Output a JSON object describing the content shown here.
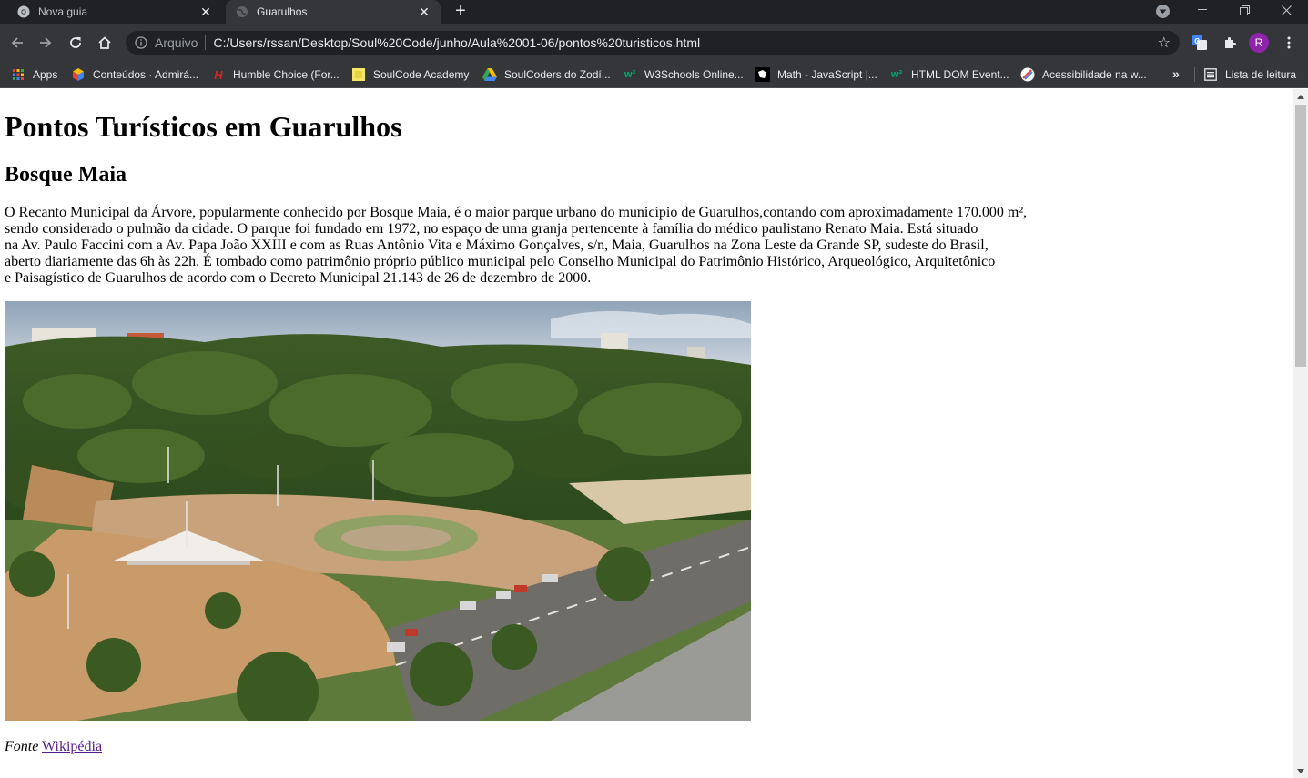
{
  "browser": {
    "tabs": [
      {
        "title": "Nova guia",
        "active": false
      },
      {
        "title": "Guarulhos",
        "active": true
      }
    ],
    "omnibox": {
      "scheme_label": "Arquivo",
      "url": "C:/Users/rssan/Desktop/Soul%20Code/junho/Aula%2001-06/pontos%20turisticos.html"
    },
    "profile_initial": "R",
    "bookmarks": [
      {
        "label": "Apps",
        "icon": "apps-grid-icon"
      },
      {
        "label": "Conteúdos · Admirá...",
        "icon": "colorful-cube-icon"
      },
      {
        "label": "Humble Choice (For...",
        "icon": "humble-h-icon"
      },
      {
        "label": "SoulCode Academy",
        "icon": "soulcode-icon"
      },
      {
        "label": "SoulCoders do Zodí...",
        "icon": "google-drive-icon"
      },
      {
        "label": "W3Schools Online...",
        "icon": "w3schools-icon"
      },
      {
        "label": "Math - JavaScript |...",
        "icon": "mdn-icon"
      },
      {
        "label": "HTML DOM Event...",
        "icon": "w3schools-icon"
      },
      {
        "label": "Acessibilidade na w...",
        "icon": "accessibility-icon"
      }
    ],
    "reading_list": "Lista de leitura",
    "colors": {
      "tabstrip": "#202124",
      "toolbar": "#35363a",
      "avatar": "#8e24aa",
      "visited_link": "#551a8b"
    }
  },
  "page": {
    "title": "Pontos Turísticos em Guarulhos",
    "section_title": "Bosque Maia",
    "description_lines": [
      "O Recanto Municipal da Árvore, popularmente conhecido por Bosque Maia, é o maior parque urbano do município de Guarulhos,contando com aproximadamente 170.000 m²,",
      "sendo considerado o pulmão da cidade. O parque foi fundado em 1972, no espaço de uma granja pertencente à família do médico paulistano Renato Maia. Está situado",
      "na Av. Paulo Faccini com a Av. Papa João XXIII e com as Ruas Antônio Vita e Máximo Gonçalves, s/n, Maia, Guarulhos na Zona Leste da Grande SP, sudeste do Brasil,",
      "aberto diariamente das 6h às 22h. É tombado como patrimônio próprio público municipal pelo Conselho Municipal do Patrimônio Histórico, Arqueológico, Arquitetônico",
      "e Paisagístico de Guarulhos de acordo com o Decreto Municipal 21.143 de 26 de dezembro de 2000."
    ],
    "photo_subject": "aerial view of Bosque Maia park",
    "source_label": "Fonte",
    "source_link": "Wikipédia"
  }
}
